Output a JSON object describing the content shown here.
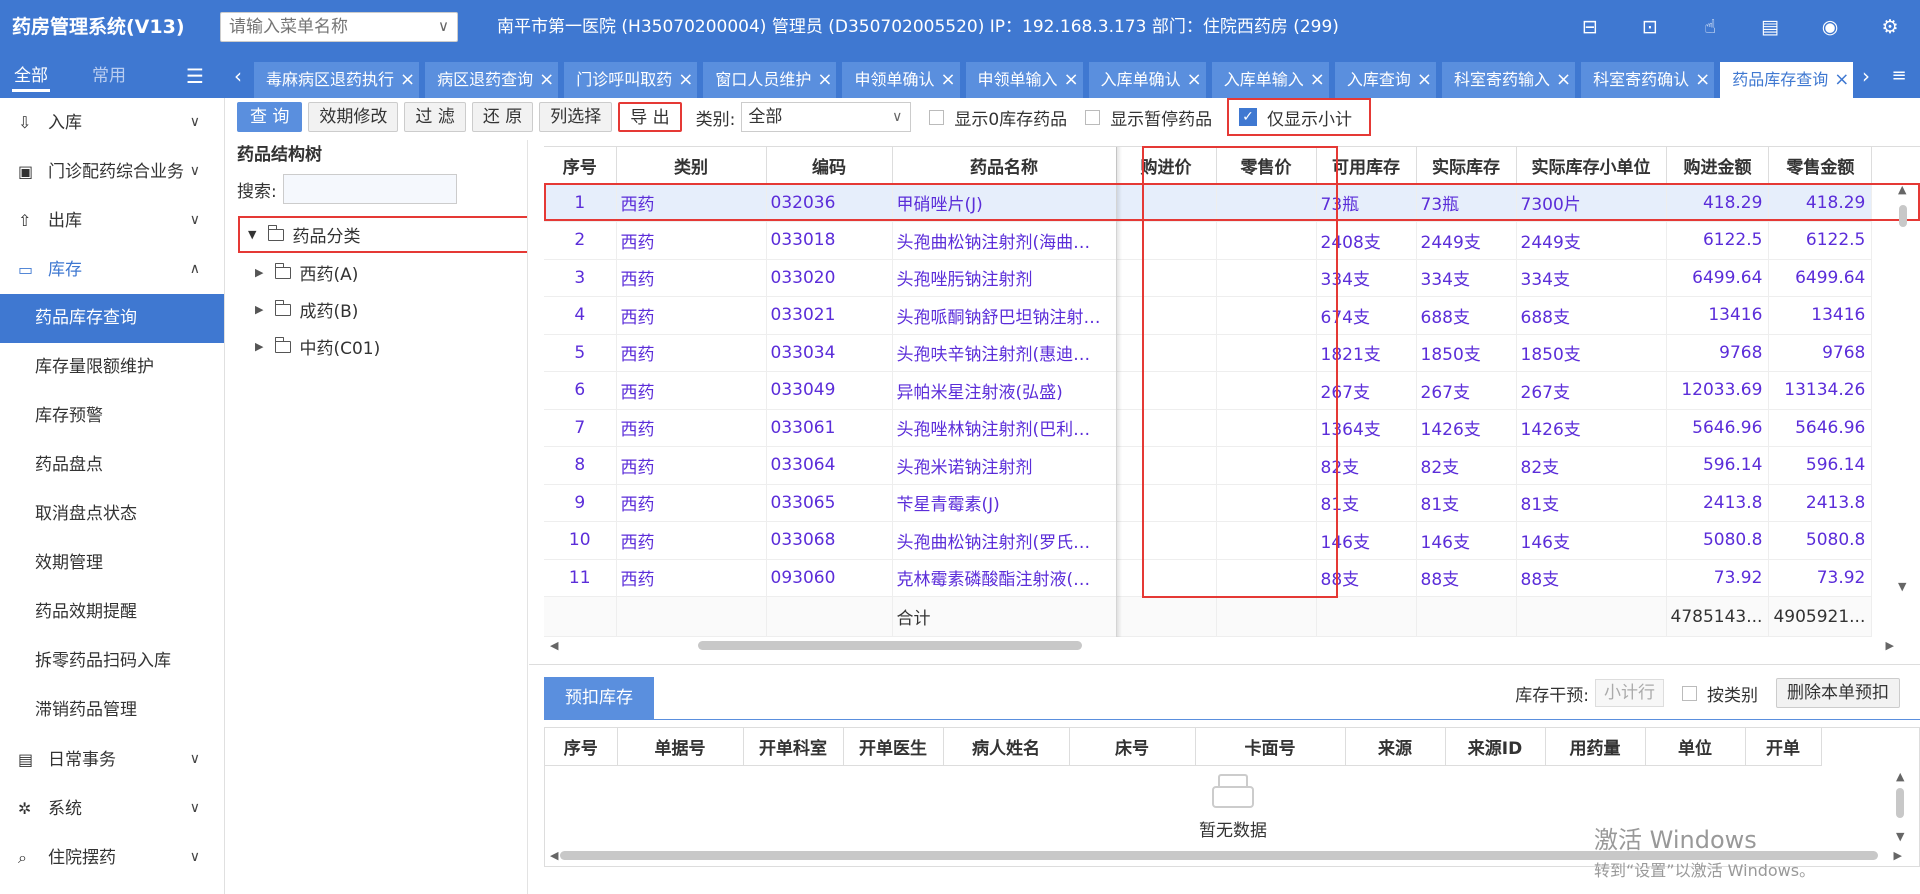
{
  "header": {
    "app_title": "药房管理系统(V13)",
    "menu_search_placeholder": "请输入菜单名称",
    "hospital_info": "南平市第一医院 (H35070200004) 管理员 (D350702005520) IP：192.168.3.173 部门：住院西药房 (299)",
    "icons": [
      "message-icon",
      "pin-icon",
      "hand-icon",
      "document-icon",
      "eye-icon",
      "gear-icon"
    ]
  },
  "sidebar": {
    "tab_all": "全部",
    "tab_common": "常用",
    "items": [
      {
        "label": "入库",
        "icon": "download-icon",
        "expanded": false
      },
      {
        "label": "门诊配药综合业务",
        "icon": "clipboard-icon",
        "expanded": false
      },
      {
        "label": "出库",
        "icon": "upload-icon",
        "expanded": false
      },
      {
        "label": "库存",
        "icon": "warehouse-icon",
        "expanded": true
      }
    ],
    "sub_items": [
      "药品库存查询",
      "库存量限额维护",
      "库存预警",
      "药品盘点",
      "取消盘点状态",
      "效期管理",
      "药品效期提醒",
      "拆零药品扫码入库",
      "滞销药品管理"
    ],
    "more_items": [
      {
        "label": "日常事务",
        "icon": "list-icon"
      },
      {
        "label": "系统",
        "icon": "gear-icon"
      },
      {
        "label": "住院摆药",
        "icon": "search-icon"
      }
    ]
  },
  "tabs": [
    "毒麻病区退药执行",
    "病区退药查询",
    "门诊呼叫取药",
    "窗口人员维护",
    "申领单确认",
    "申领单输入",
    "入库单确认",
    "入库单输入",
    "入库查询",
    "科室寄药输入",
    "科室寄药确认",
    "药品库存查询"
  ],
  "active_tab": "药品库存查询",
  "toolbar": {
    "query": "查 询",
    "expiry_edit": "效期修改",
    "filter": "过 滤",
    "restore": "还 原",
    "column_select": "列选择",
    "export": "导 出",
    "category_label": "类别:",
    "category_value": "全部",
    "show_zero": "显示0库存药品",
    "show_suspended": "显示暂停药品",
    "subtotal_only": "仅显示小计"
  },
  "tree": {
    "title": "药品结构树",
    "search_label": "搜索:",
    "root": "药品分类",
    "children": [
      "西药(A)",
      "成药(B)",
      "中药(C01)"
    ]
  },
  "grid": {
    "headers": [
      "序号",
      "类别",
      "编码",
      "药品名称",
      "购进价",
      "零售价",
      "可用库存",
      "实际库存",
      "实际库存小单位",
      "购进金额",
      "零售金额"
    ],
    "rows": [
      [
        "1",
        "西药",
        "032036",
        "甲硝唑片(J)",
        "",
        "",
        "73瓶",
        "73瓶",
        "7300片",
        "418.29",
        "418.29"
      ],
      [
        "2",
        "西药",
        "033018",
        "头孢曲松钠注射剂(海曲…",
        "",
        "",
        "2408支",
        "2449支",
        "2449支",
        "6122.5",
        "6122.5"
      ],
      [
        "3",
        "西药",
        "033020",
        "头孢唑肟钠注射剂",
        "",
        "",
        "334支",
        "334支",
        "334支",
        "6499.64",
        "6499.64"
      ],
      [
        "4",
        "西药",
        "033021",
        "头孢哌酮钠舒巴坦钠注射…",
        "",
        "",
        "674支",
        "688支",
        "688支",
        "13416",
        "13416"
      ],
      [
        "5",
        "西药",
        "033034",
        "头孢呋辛钠注射剂(惠迪…",
        "",
        "",
        "1821支",
        "1850支",
        "1850支",
        "9768",
        "9768"
      ],
      [
        "6",
        "西药",
        "033049",
        "异帕米星注射液(弘盛)",
        "",
        "",
        "267支",
        "267支",
        "267支",
        "12033.69",
        "13134.26"
      ],
      [
        "7",
        "西药",
        "033061",
        "头孢唑林钠注射剂(巴利…",
        "",
        "",
        "1364支",
        "1426支",
        "1426支",
        "5646.96",
        "5646.96"
      ],
      [
        "8",
        "西药",
        "033064",
        "头孢米诺钠注射剂",
        "",
        "",
        "82支",
        "82支",
        "82支",
        "596.14",
        "596.14"
      ],
      [
        "9",
        "西药",
        "033065",
        "苄星青霉素(J)",
        "",
        "",
        "81支",
        "81支",
        "81支",
        "2413.8",
        "2413.8"
      ],
      [
        "10",
        "西药",
        "033068",
        "头孢曲松钠注射剂(罗氏…",
        "",
        "",
        "146支",
        "146支",
        "146支",
        "5080.8",
        "5080.8"
      ],
      [
        "11",
        "西药",
        "093060",
        "克林霉素磷酸酯注射液(…",
        "",
        "",
        "88支",
        "88支",
        "88支",
        "73.92",
        "73.92"
      ]
    ],
    "total_label": "合计",
    "total_purchase": "4785143...",
    "total_retail": "4905921..."
  },
  "bottom": {
    "tab": "预扣库存",
    "intervene_label": "库存干预:",
    "subtotal_btn": "小计行",
    "by_category": "按类别",
    "delete_btn": "删除本单预扣",
    "headers": [
      "序号",
      "单据号",
      "开单科室",
      "开单医生",
      "病人姓名",
      "床号",
      "卡面号",
      "来源",
      "来源ID",
      "用药量",
      "单位",
      "开单"
    ],
    "empty_text": "暂无数据"
  },
  "watermark": {
    "line1": "激活 Windows",
    "line2": "转到“设置”以激活 Windows。"
  }
}
